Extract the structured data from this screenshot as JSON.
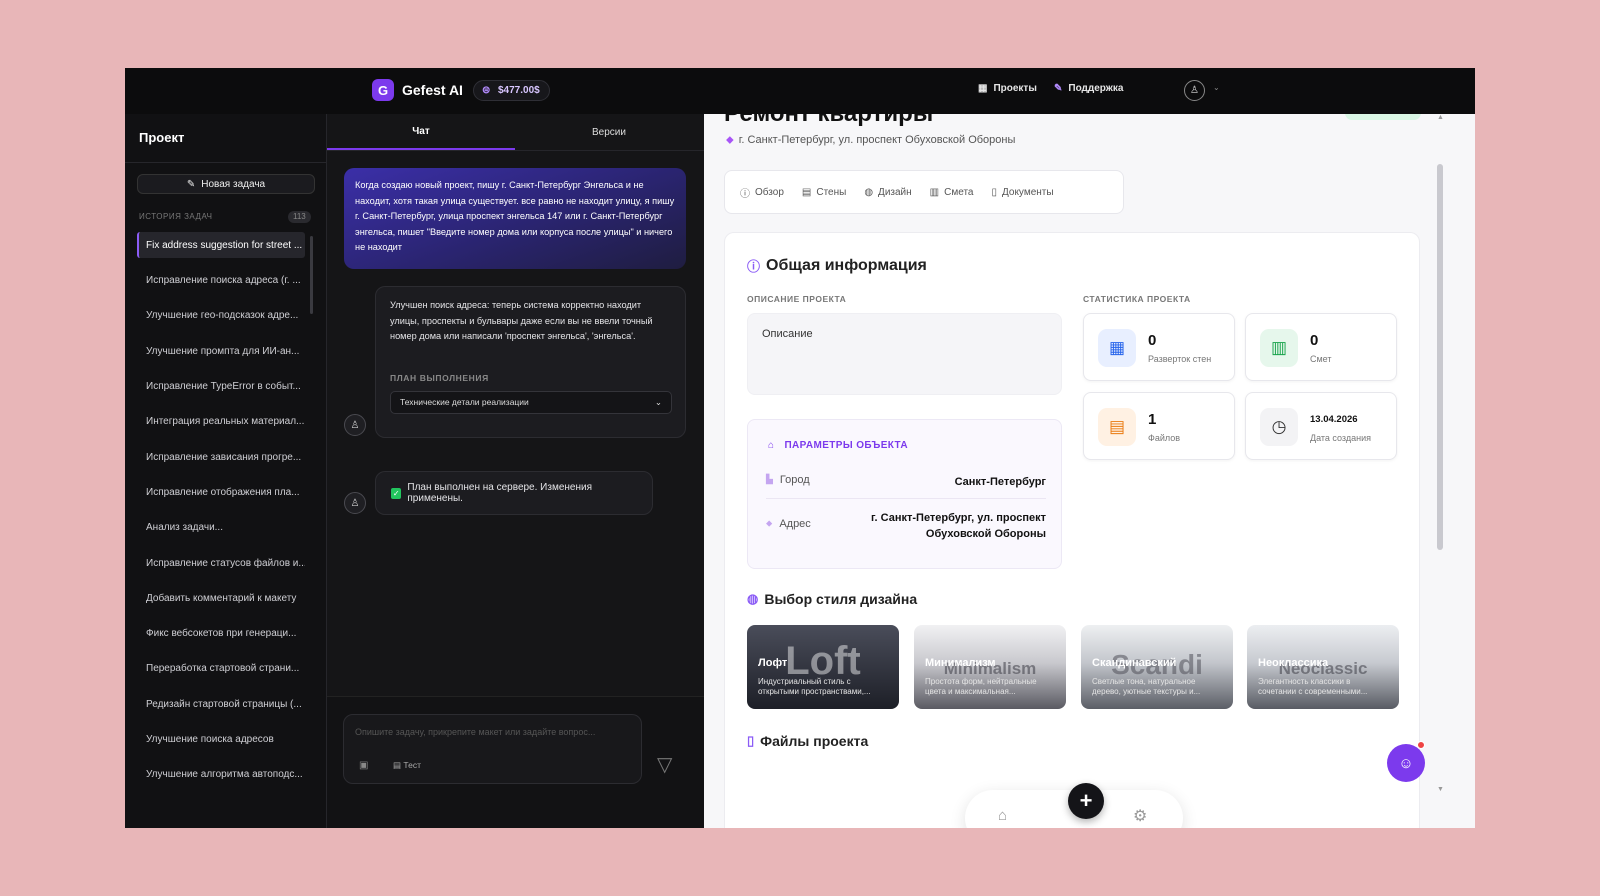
{
  "topbar": {
    "logo_letter": "G",
    "app_name": "Gefest AI",
    "balance": "$477.00$",
    "nav_projects": "Проекты",
    "nav_support": "Поддержка"
  },
  "sidebar": {
    "title": "Проект",
    "new_task": "Новая задача",
    "history_label": "ИСТОРИЯ ЗАДАЧ",
    "history_count": "113",
    "items": [
      "Fix address suggestion for street ...",
      "Исправление поиска адреса (г. ...",
      "Улучшение гео-подсказок адре...",
      "Улучшение промпта для ИИ-ан...",
      "Исправление TypeError в событ...",
      "Интеграция реальных материал...",
      "Исправление зависания прогре...",
      "Исправление отображения пла...",
      "Анализ задачи...",
      "Исправление статусов файлов и...",
      "Добавить комментарий к макету",
      "Фикс вебсокетов при генераци...",
      "Переработка стартовой страни...",
      "Редизайн стартовой страницы (...",
      "Улучшение поиска адресов",
      "Улучшение алгоритма автоподс..."
    ]
  },
  "chat": {
    "tab_chat": "Чат",
    "tab_versions": "Версии",
    "user_message": "Когда создаю новый проект, пишу г. Санкт-Петербург Энгельса и не находит, хотя такая улица существует. все равно не находит улицу, я пишу г. Санкт-Петербург, улица проспект энгельса 147 или г. Санкт-Петербург энгельса, пишет \"Введите номер дома или корпуса после улицы\" и ничего не находит",
    "assistant_message": "Улучшен поиск адреса: теперь система корректно находит улицы, проспекты и бульвары даже если вы не ввели точный номер дома или написали 'проспект энгельса', 'энгельса'.",
    "plan_label": "ПЛАН ВЫПОЛНЕНИЯ",
    "plan_select": "Технические детали реализации",
    "done_message": "План выполнен на сервере. Изменения применены.",
    "input_placeholder": "Опишите задачу, прикрепите макет или задайте вопрос...",
    "test_label": "Тест"
  },
  "main": {
    "title": "Ремонт квартиры",
    "address": "г. Санкт-Петербург, ул. проспект Обуховской Обороны",
    "tabs": [
      "Обзор",
      "Стены",
      "Дизайн",
      "Смета",
      "Документы"
    ],
    "general_title": "Общая информация",
    "desc_label": "ОПИСАНИЕ ПРОЕКТА",
    "desc_text": "Описание",
    "stats_label": "СТАТИСТИКА ПРОЕКТА",
    "params_title": "ПАРАМЕТРЫ ОБЪЕКТА",
    "city_label": "Город",
    "city_value": "Санкт-Петербург",
    "address_label": "Адрес",
    "address_value": "г. Санкт-Петербург, ул. проспект Обуховской Обороны",
    "stats": [
      {
        "value": "0",
        "label": "Разверток стен"
      },
      {
        "value": "0",
        "label": "Смет"
      },
      {
        "value": "1",
        "label": "Файлов"
      },
      {
        "value": "13.04.2026",
        "label": "Дата создания"
      }
    ],
    "design_title": "Выбор стиля дизайна",
    "styles": [
      {
        "big": "Loft",
        "name": "Лофт",
        "desc": "Индустриальный стиль с открытыми пространствами,..."
      },
      {
        "big": "Minimalism",
        "name": "Минимализм",
        "desc": "Простота форм, нейтральные цвета и максимальная..."
      },
      {
        "big": "Scandi",
        "name": "Скандинавский",
        "desc": "Светлые тона, натуральное дерево, уютные текстуры и..."
      },
      {
        "big": "Neoclassic",
        "name": "Неоклассика",
        "desc": "Элегантность классики в сочетании с современными..."
      }
    ],
    "files_title": "Файлы проекта"
  }
}
